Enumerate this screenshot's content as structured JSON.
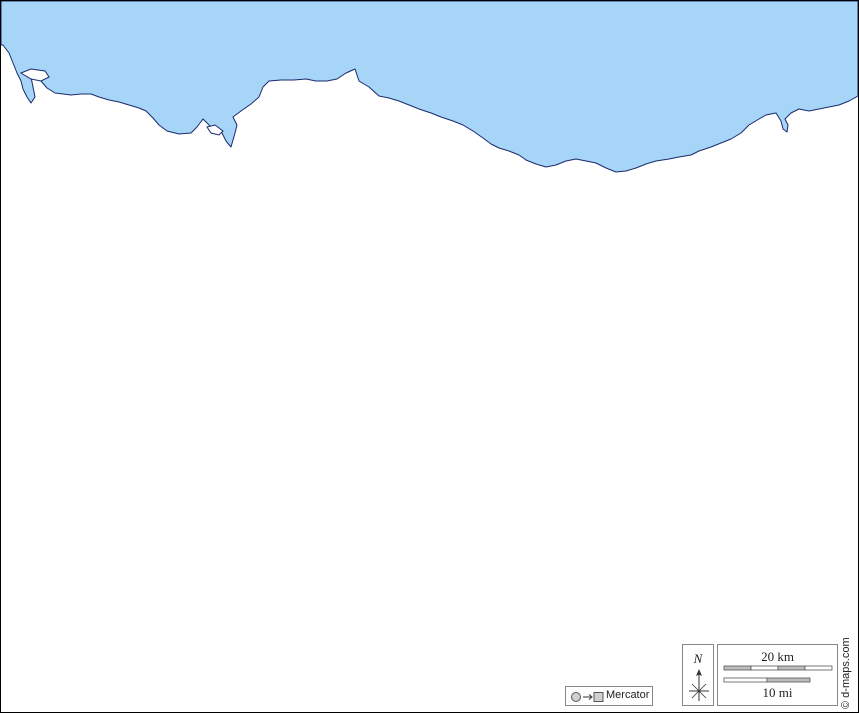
{
  "map": {
    "projection": "Mercator",
    "colors": {
      "sea": "#a6d5f7",
      "land": "#ffffff",
      "coastline": "#1a2a6c",
      "frame": "#000000"
    }
  },
  "compass": {
    "north_label": "N"
  },
  "scale_bar": {
    "km_label": "20 km",
    "mi_label": "10 mi"
  },
  "credit": "© d-maps.com"
}
